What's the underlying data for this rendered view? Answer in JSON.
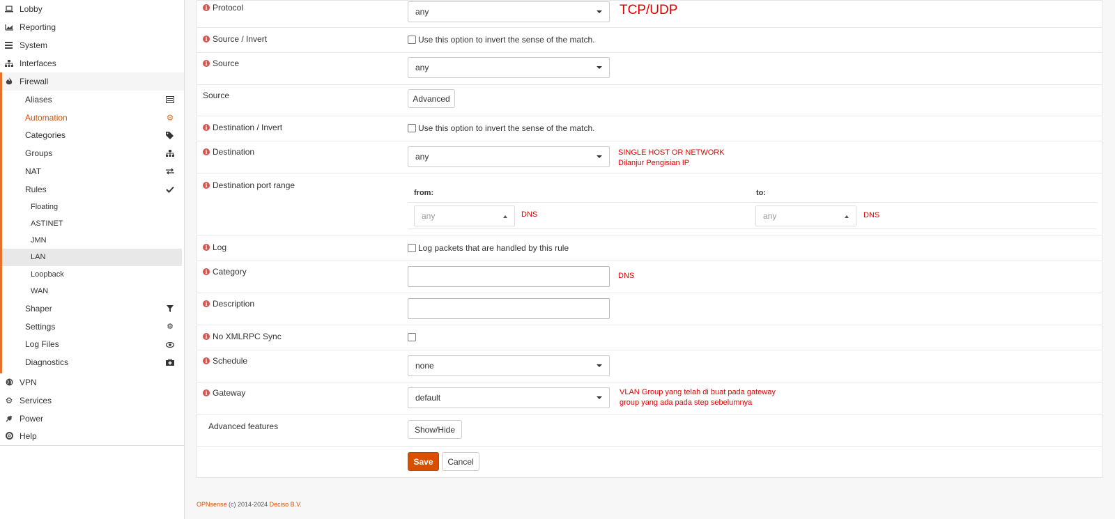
{
  "sidebar": {
    "top_items": [
      {
        "label": "Lobby",
        "icon": "laptop-icon"
      },
      {
        "label": "Reporting",
        "icon": "area-chart-icon"
      },
      {
        "label": "System",
        "icon": "server-icon"
      },
      {
        "label": "Interfaces",
        "icon": "sitemap-icon"
      }
    ],
    "firewall": {
      "label": "Firewall",
      "icon": "fire-icon"
    },
    "firewall_items": [
      {
        "label": "Aliases",
        "icon": "list-icon"
      },
      {
        "label": "Automation",
        "icon": "gear-icon"
      },
      {
        "label": "Categories",
        "icon": "tags-icon"
      },
      {
        "label": "Groups",
        "icon": "sitemap-icon"
      },
      {
        "label": "NAT",
        "icon": "exchange-icon"
      },
      {
        "label": "Rules",
        "icon": "check-icon"
      }
    ],
    "rules_items": [
      "Floating",
      "ASTINET",
      "JMN",
      "LAN",
      "Loopback",
      "WAN"
    ],
    "firewall_items2": [
      {
        "label": "Shaper",
        "icon": "filter-icon"
      },
      {
        "label": "Settings",
        "icon": "gears-icon"
      },
      {
        "label": "Log Files",
        "icon": "eye-icon"
      },
      {
        "label": "Diagnostics",
        "icon": "medkit-icon"
      }
    ],
    "bottom_items": [
      {
        "label": "VPN",
        "icon": "globe-icon"
      },
      {
        "label": "Services",
        "icon": "gear-icon"
      },
      {
        "label": "Power",
        "icon": "plug-icon"
      },
      {
        "label": "Help",
        "icon": "life-ring-icon"
      }
    ]
  },
  "form": {
    "protocol": {
      "label": "Protocol",
      "value": "any",
      "note": "TCP/UDP"
    },
    "source_invert": {
      "label": "Source / Invert",
      "checkbox_text": "Use this option to invert the sense of the match."
    },
    "source": {
      "label": "Source",
      "value": "any"
    },
    "source_advanced": {
      "label": "Source",
      "button": "Advanced"
    },
    "destination_invert": {
      "label": "Destination / Invert",
      "checkbox_text": "Use this option to invert the sense of the match."
    },
    "destination": {
      "label": "Destination",
      "value": "any",
      "note_line1": "SINGLE HOST OR NETWORK",
      "note_line2": "Dilanjur Pengisian IP"
    },
    "dest_port_range": {
      "label": "Destination port range",
      "from_label": "from:",
      "to_label": "to:",
      "from_value": "any",
      "to_value": "any",
      "from_note": "DNS",
      "to_note": "DNS"
    },
    "log": {
      "label": "Log",
      "checkbox_text": "Log packets that are handled by this rule"
    },
    "category": {
      "label": "Category",
      "note": "DNS"
    },
    "description": {
      "label": "Description"
    },
    "no_xmlrpc": {
      "label": "No XMLRPC Sync"
    },
    "schedule": {
      "label": "Schedule",
      "value": "none"
    },
    "gateway": {
      "label": "Gateway",
      "value": "default",
      "note_line1": "VLAN Group yang telah di buat pada gateway",
      "note_line2": "group yang ada pada step sebelumnya"
    },
    "advanced_features": {
      "label": "Advanced features",
      "button": "Show/Hide"
    },
    "save": "Save",
    "cancel": "Cancel"
  },
  "footer": {
    "brand": "OPNsense",
    "copyright": "(c) 2014-2024",
    "company": "Deciso B.V."
  },
  "colors": {
    "accent": "#d94f00",
    "annotation": "#e00000",
    "info_icon": "#d9534f"
  }
}
